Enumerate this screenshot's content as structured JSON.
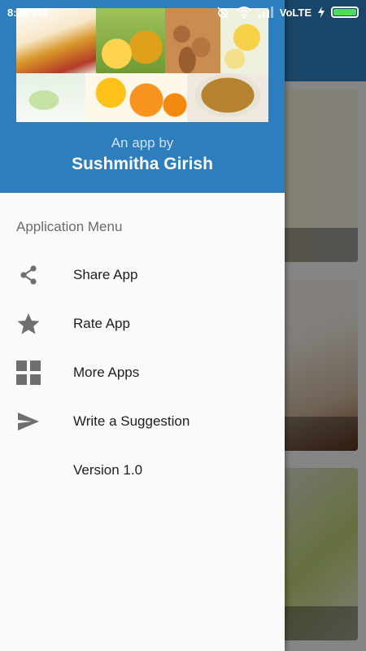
{
  "status_bar": {
    "time": "8:36 PM",
    "network": "VoLTE"
  },
  "drawer": {
    "subtitle": "An app by",
    "author": "Sushmitha Girish",
    "menu_heading": "Application Menu",
    "items": [
      {
        "label": "Share App",
        "icon": "share-icon"
      },
      {
        "label": "Rate App",
        "icon": "star-icon"
      },
      {
        "label": "More Apps",
        "icon": "grid-icon"
      },
      {
        "label": "Write a Suggestion",
        "icon": "send-icon"
      },
      {
        "label": "Version 1.0",
        "icon": ""
      }
    ]
  },
  "colors": {
    "header_blue": "#2e7ebd",
    "icon_gray": "#6f6f6f",
    "battery_green": "#4cd964"
  }
}
